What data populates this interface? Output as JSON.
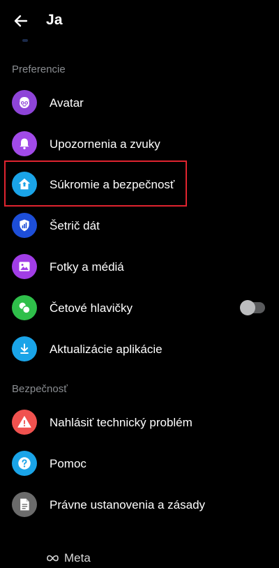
{
  "header": {
    "title": "Ja",
    "back_icon": "arrow-left-icon"
  },
  "sections": {
    "preferences": "Preferencie",
    "security": "Bezpečnosť"
  },
  "preferences_items": [
    {
      "label": "Avatar",
      "icon": "avatar-face-icon",
      "color": "#8e44d8"
    },
    {
      "label": "Upozornenia a zvuky",
      "icon": "bell-icon",
      "color": "#a14ae8"
    },
    {
      "label": "Súkromie a bezpečnosť",
      "icon": "home-shield-icon",
      "color": "#1aa4e8",
      "highlighted": true
    },
    {
      "label": "Šetrič dát",
      "icon": "data-shield-icon",
      "color": "#1d4ed8"
    },
    {
      "label": "Fotky a médiá",
      "icon": "photo-icon",
      "color": "#a13de6"
    },
    {
      "label": "Četové hlavičky",
      "icon": "chat-heads-icon",
      "color": "#2fbf4a",
      "toggle": false
    },
    {
      "label": "Aktualizácie aplikácie",
      "icon": "download-icon",
      "color": "#1aa4e8"
    }
  ],
  "security_items": [
    {
      "label": "Nahlásiť technický problém",
      "icon": "warning-icon",
      "color": "#f0524f"
    },
    {
      "label": "Pomoc",
      "icon": "help-icon",
      "color": "#1aa4e8"
    },
    {
      "label": "Právne ustanovenia a zásady",
      "icon": "document-icon",
      "color": "#6b6b6b"
    }
  ],
  "footer": {
    "brand": "Meta"
  }
}
